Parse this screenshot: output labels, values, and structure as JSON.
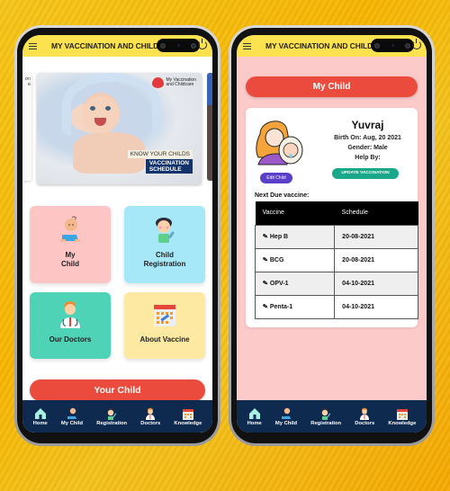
{
  "app": {
    "title": "MY VACCINATION AND CHILDCARE",
    "brand_line1": "My Vaccination",
    "brand_line2": "and Childcare",
    "accent_color": "#fde24f",
    "nav_color": "#0f2a4f",
    "button_color": "#ea4b3d"
  },
  "home_screen": {
    "banner": {
      "side_text": "on\ne",
      "tagline": "KNOW YOUR CHILDS",
      "headline": "VACCINATION\nSCHEDULE"
    },
    "tiles": [
      {
        "label": "My\nChild",
        "icon": "crawling-baby-icon",
        "color": "#fec5c5"
      },
      {
        "label": "Child\nRegistration",
        "icon": "nurse-vaccine-icon",
        "color": "#a6e8f8"
      },
      {
        "label": "Our Doctors",
        "icon": "doctor-icon",
        "color": "#4fd3b6"
      },
      {
        "label": "About Vaccine",
        "icon": "calendar-vaccine-icon",
        "color": "#fde9a1"
      }
    ],
    "your_child_button": "Your Child"
  },
  "child_screen": {
    "header_button": "My Child",
    "child": {
      "name": "Yuvraj",
      "birth": "Birth On: Aug, 20 2021",
      "gender": "Gender: Male",
      "help_by": "Help By:"
    },
    "edit_button": "Edit Child",
    "update_button": "UPDATE VACCINATION",
    "next_due_label": "Next Due vaccine:",
    "table": {
      "headers": [
        "Vaccine",
        "Schedule"
      ],
      "rows": [
        {
          "vaccine": "Hep B",
          "schedule": "20-08-2021"
        },
        {
          "vaccine": "BCG",
          "schedule": "20-08-2021"
        },
        {
          "vaccine": "OPV-1",
          "schedule": "04-10-2021"
        },
        {
          "vaccine": "Penta-1",
          "schedule": "04-10-2021"
        }
      ]
    }
  },
  "bottom_nav": [
    {
      "label": "Home",
      "icon": "home-icon"
    },
    {
      "label": "My Child",
      "icon": "baby-icon"
    },
    {
      "label": "Registration",
      "icon": "registration-icon"
    },
    {
      "label": "Doctors",
      "icon": "doctor-icon"
    },
    {
      "label": "Knowledge",
      "icon": "calendar-icon"
    }
  ]
}
